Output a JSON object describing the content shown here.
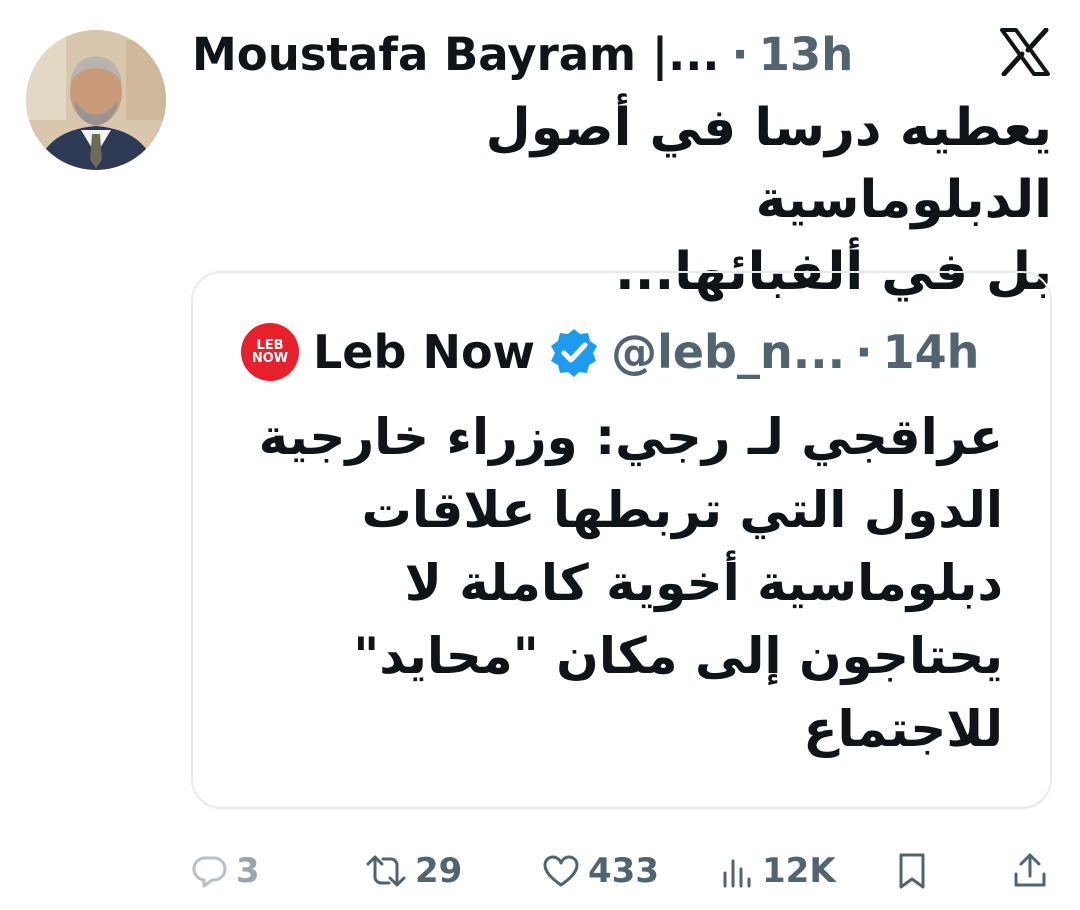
{
  "tweet": {
    "author_name": "Moustafa Bayram |...",
    "time": "13h",
    "text_line1": "يعطيه درسا في أصول الدبلوماسية",
    "text_line2": "بل في ألفبائها..."
  },
  "quoted_tweet": {
    "logo_text_top": "LEB",
    "logo_text_bottom": "NOW",
    "author_name": "Leb Now",
    "handle": "@leb_n...",
    "time": "14h",
    "lines": [
      "عراقجي لـ رجي: وزراء خارجية",
      "الدول التي تربطها علاقات",
      "دبلوماسية أخوية كاملة لا",
      "يحتاجون إلى مكان \"محايد\"",
      "للاجتماع"
    ]
  },
  "separator_dot": "·",
  "actions": {
    "replies": "3",
    "retweets": "29",
    "likes": "433",
    "views": "12K"
  },
  "colors": {
    "text": "#0f1419",
    "secondary": "#536471",
    "verified": "#1d9bf0",
    "leb_now_red": "#e8202b",
    "border": "#e7e9ec"
  },
  "icons": [
    "x-logo-icon",
    "verified-badge-icon",
    "reply-icon",
    "retweet-icon",
    "like-icon",
    "views-icon",
    "bookmark-icon",
    "share-icon"
  ]
}
